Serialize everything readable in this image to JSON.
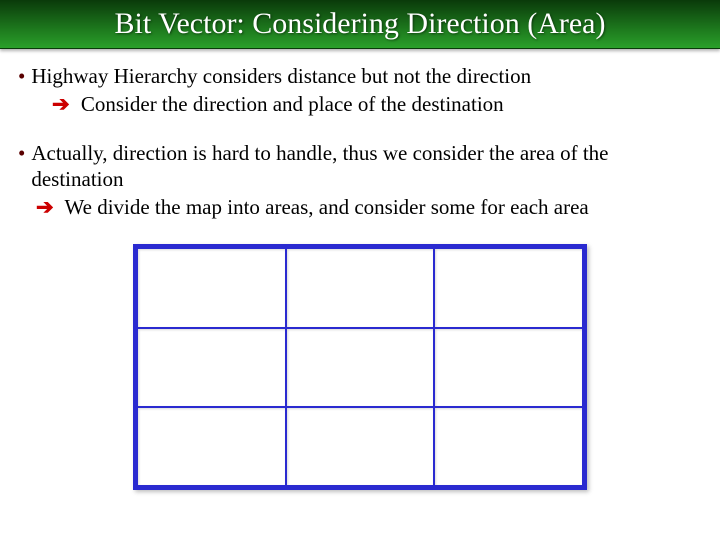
{
  "title": "Bit Vector: Considering Direction (Area)",
  "bullets": [
    {
      "text": "Highway Hierarchy considers distance but not the direction",
      "sub": " Consider the direction and place of the destination"
    },
    {
      "text": "Actually, direction is hard to handle, thus we consider the area of the destination",
      "sub": " We divide the map into areas, and consider some for each area"
    }
  ],
  "grid": {
    "rows": 3,
    "cols": 3
  },
  "colors": {
    "header_gradient_dark": "#0a3a0a",
    "header_gradient_light": "#2aa02a",
    "bullet_dot": "#5a0000",
    "arrow": "#cc0000",
    "grid_border": "#2a2ad0"
  }
}
